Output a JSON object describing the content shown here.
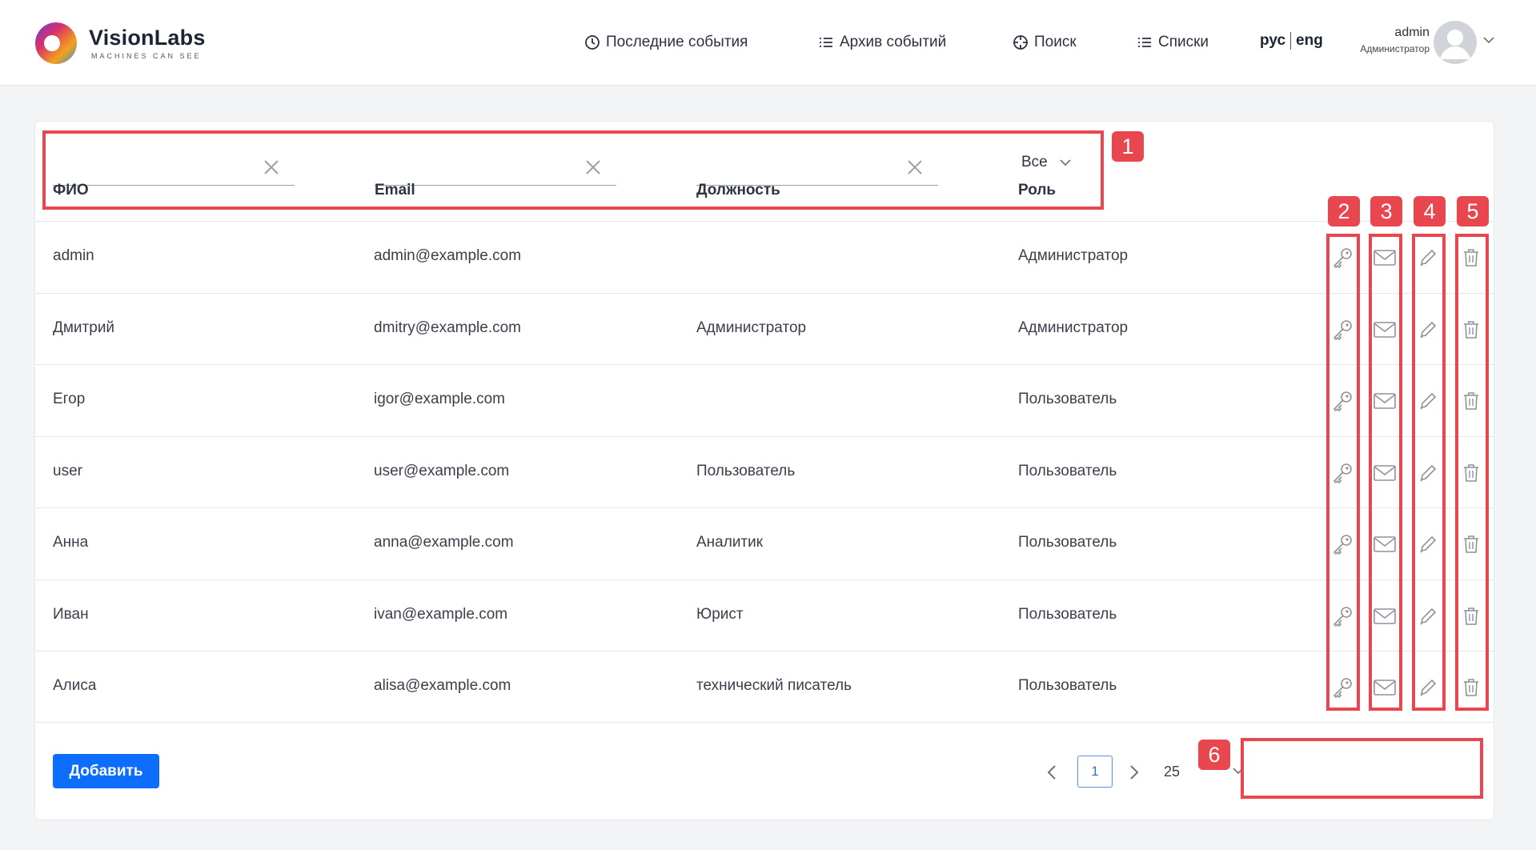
{
  "header": {
    "brand_name": "VisionLabs",
    "brand_tagline": "MACHINES CAN SEE",
    "nav": [
      {
        "label": "Последние события",
        "icon": "clock-icon"
      },
      {
        "label": "Архив событий",
        "icon": "list-icon"
      },
      {
        "label": "Поиск",
        "icon": "crosshair-icon"
      },
      {
        "label": "Списки",
        "icon": "list-icon"
      }
    ],
    "lang": {
      "ru": "рус",
      "en": "eng"
    },
    "user": {
      "name": "admin",
      "role": "Администратор"
    }
  },
  "filters": {
    "name_label": "ФИО",
    "email_label": "Email",
    "position_label": "Должность",
    "role_label": "Роль",
    "role_value": "Все",
    "name_value": "",
    "email_value": "",
    "position_value": ""
  },
  "users": [
    {
      "name": "admin",
      "email": "admin@example.com",
      "position": "",
      "role": "Администратор"
    },
    {
      "name": "Дмитрий",
      "email": "dmitry@example.com",
      "position": "Администратор",
      "role": "Администратор"
    },
    {
      "name": "Егор",
      "email": "igor@example.com",
      "position": "",
      "role": "Пользователь"
    },
    {
      "name": "user",
      "email": "user@example.com",
      "position": "Пользователь",
      "role": "Пользователь"
    },
    {
      "name": "Анна",
      "email": "anna@example.com",
      "position": "Аналитик",
      "role": "Пользователь"
    },
    {
      "name": "Иван",
      "email": "ivan@example.com",
      "position": "Юрист",
      "role": "Пользователь"
    },
    {
      "name": "Алиса",
      "email": "alisa@example.com",
      "position": "технический писатель",
      "role": "Пользователь"
    }
  ],
  "row_actions": [
    "key-icon",
    "mail-icon",
    "pencil-icon",
    "trash-icon"
  ],
  "footer": {
    "add_label": "Добавить"
  },
  "pagination": {
    "current_page": "1",
    "page_size": "25"
  },
  "annotations": [
    "1",
    "2",
    "3",
    "4",
    "5",
    "6"
  ],
  "colors": {
    "accent": "#0d6efd",
    "annotation": "#e8474f",
    "background": "#f3f4f6"
  }
}
